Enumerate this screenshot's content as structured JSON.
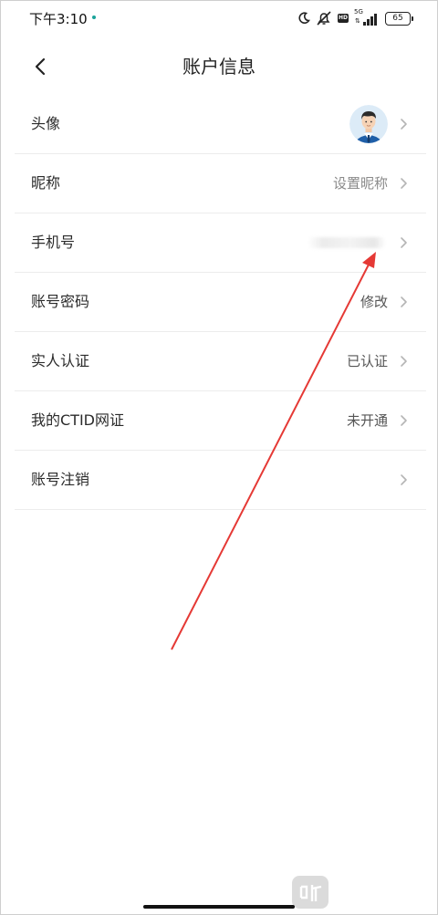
{
  "status_bar": {
    "time": "下午3:10",
    "network": "5G",
    "battery_level": "65",
    "accent_color": "#1aa39a"
  },
  "header": {
    "back_icon": "chevron-left-icon",
    "title": "账户信息"
  },
  "rows": [
    {
      "key": "avatar",
      "label": "头像",
      "value": ""
    },
    {
      "key": "nickname",
      "label": "昵称",
      "value": "设置昵称"
    },
    {
      "key": "phone",
      "label": "手机号",
      "value": ""
    },
    {
      "key": "password",
      "label": "账号密码",
      "value": "修改"
    },
    {
      "key": "verification",
      "label": "实人认证",
      "value": "已认证"
    },
    {
      "key": "ctid",
      "label": "我的CTID网证",
      "value": "未开通"
    },
    {
      "key": "cancel",
      "label": "账号注销",
      "value": ""
    }
  ],
  "annotation": {
    "color": "#e53935"
  }
}
